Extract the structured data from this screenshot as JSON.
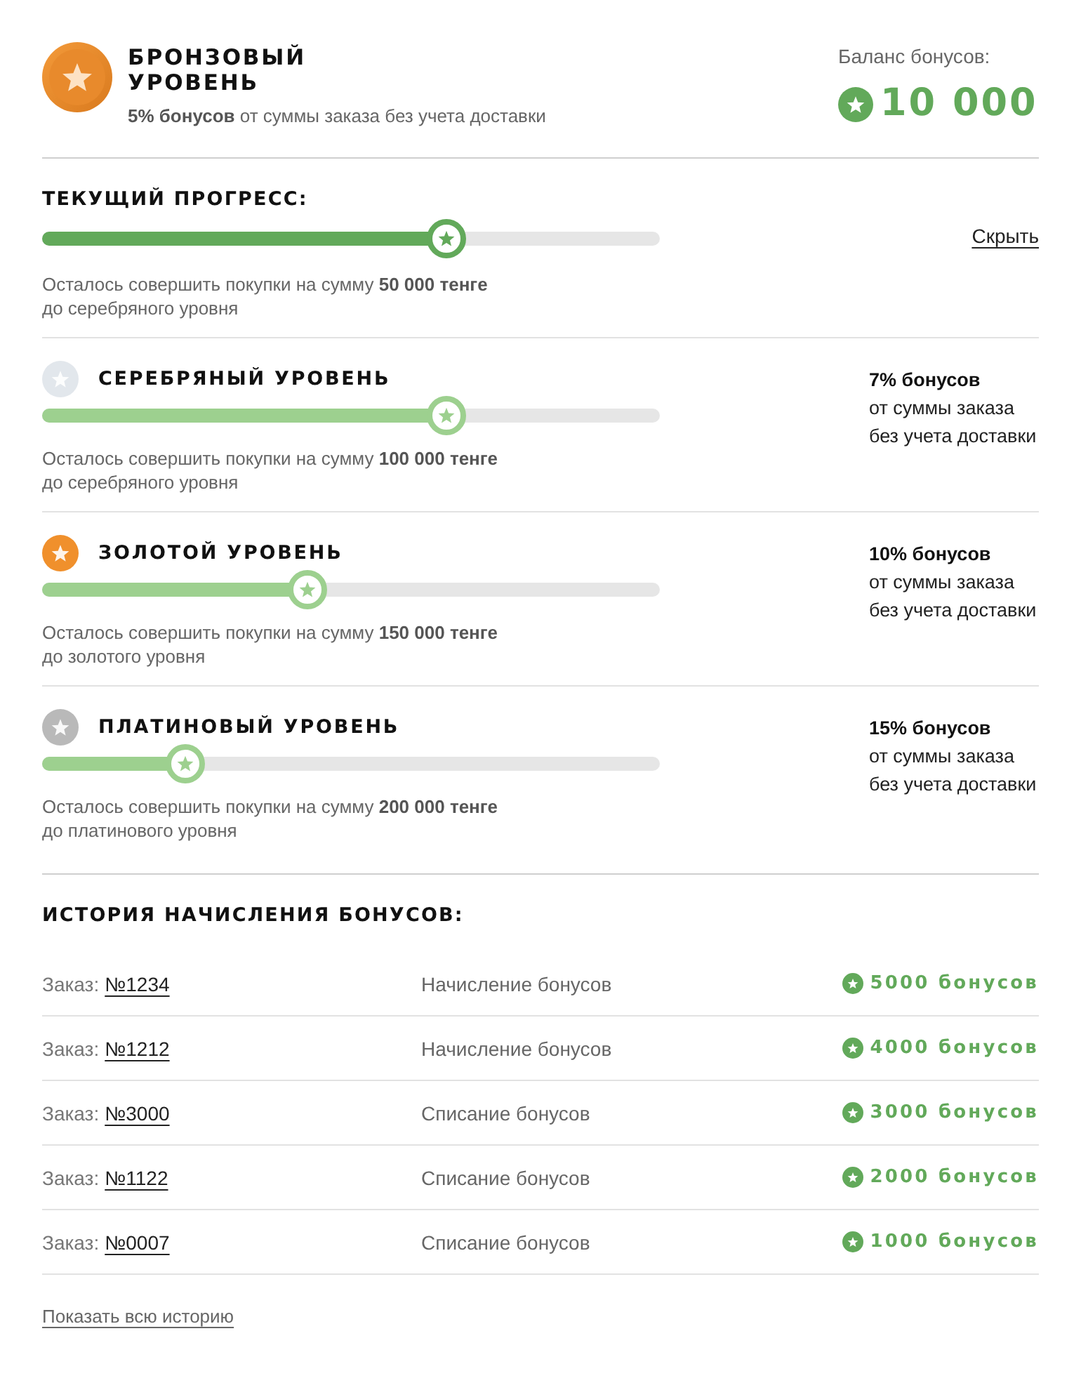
{
  "header": {
    "title": "БРОНЗОВЫЙ УРОВЕНЬ",
    "subtitle": "**5% бонусов** от суммы заказа без учета доставки"
  },
  "balance": {
    "label": "Баланс бонусов:",
    "value": "10 000"
  },
  "current_progress": {
    "heading": "ТЕКУЩИЙ ПРОГРЕСС:",
    "level": 0.655,
    "hide_link": "Скрыть",
    "remaining": [
      "Осталось совершить покупки на сумму **50 000 тенге**",
      "до серебряного уровня"
    ]
  },
  "levels": [
    {
      "title": "СЕРЕБРЯНЫЙ УРОВЕНЬ",
      "color": "#e2e7ec",
      "level": 0.655,
      "remaining": [
        "Осталось совершить покупки на сумму **100 000 тенге**",
        "до серебряного уровня"
      ],
      "bonus": [
        "**7% бонусов**",
        "от суммы заказа",
        "без учета доставки"
      ]
    },
    {
      "title": "ЗОЛОТОЙ УРОВЕНЬ",
      "color": "#f0902c",
      "level": 0.43,
      "remaining": [
        "Осталось совершить покупки на сумму **150 000 тенге**",
        "до золотого уровня"
      ],
      "bonus": [
        "**10% бонусов**",
        "от суммы заказа",
        "без учета доставки"
      ]
    },
    {
      "title": "ПЛАТИНОВЫЙ УРОВЕНЬ",
      "color": "#b9b9b9",
      "level": 0.232,
      "remaining": [
        "Осталось совершить покупки на сумму **200 000 тенге**",
        "до платинового уровня"
      ],
      "bonus": [
        "**15% бонусов**",
        "от суммы заказа",
        "без учета доставки"
      ]
    }
  ],
  "history": {
    "heading": "ИСТОРИЯ НАЧИСЛЕНИЯ БОНУСОВ:",
    "rows": [
      {
        "order_label": "Заказ:",
        "order_number": "№1234",
        "operation": "Начисление бонусов",
        "amount": "5000 бонусов"
      },
      {
        "order_label": "Заказ:",
        "order_number": "№1212",
        "operation": "Начисление бонусов",
        "amount": "4000 бонусов"
      },
      {
        "order_label": "Заказ:",
        "order_number": "№3000",
        "operation": "Списание бонусов",
        "amount": "3000 бонусов"
      },
      {
        "order_label": "Заказ:",
        "order_number": "№1122",
        "operation": "Списание бонусов",
        "amount": "2000 бонусов"
      },
      {
        "order_label": "Заказ:",
        "order_number": "№0007",
        "operation": "Списание бонусов",
        "amount": "1000 бонусов"
      }
    ],
    "show_all_link": "Показать всю историю"
  }
}
